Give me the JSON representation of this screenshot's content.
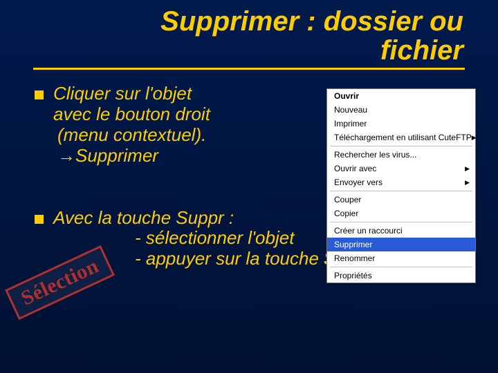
{
  "title": {
    "line1": "Supprimer : dossier ou",
    "line2": "fichier"
  },
  "bullets": [
    {
      "l1": "Cliquer sur l'objet",
      "l2": "avec le bouton droit",
      "l3": "(menu contextuel).",
      "l4": "→Supprimer"
    },
    {
      "l1": "Avec la touche Suppr :",
      "l2": "- sélectionner l'objet",
      "l3a": "- appuyer sur la touche ",
      "l3b": "Suppr",
      "l3c": "."
    }
  ],
  "stamp": "Sélection",
  "menu": {
    "open": "Ouvrir",
    "new": "Nouveau",
    "print": "Imprimer",
    "ftp": "Téléchargement en utilisant CuteFTP",
    "virus": "Rechercher les virus...",
    "openwith": "Ouvrir avec",
    "sendto": "Envoyer vers",
    "cut": "Couper",
    "copy": "Copier",
    "shortcut": "Créer un raccourci",
    "delete": "Supprimer",
    "rename": "Renommer",
    "props": "Propriétés"
  }
}
